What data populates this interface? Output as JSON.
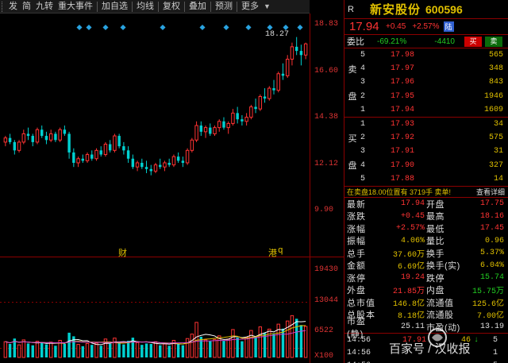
{
  "toolbar": {
    "items": [
      "发",
      "简",
      "九转",
      "重大事件",
      "加自选",
      "均线",
      "复权",
      "叠加",
      "预测",
      "更多"
    ]
  },
  "chart": {
    "y_labels": [
      "18.83",
      "16.60",
      "14.38",
      "12.12",
      "9.90"
    ],
    "max_annot": "18.27",
    "events": [
      {
        "text": "财"
      },
      {
        "text": "港"
      },
      {
        "text": "q"
      }
    ],
    "vol_labels": [
      "19430",
      "13044",
      "6522"
    ],
    "vol_unit": "X100"
  },
  "chart_data": {
    "type": "candlestick",
    "ylim": [
      9.9,
      18.83
    ],
    "volume_ylim": [
      0,
      19430
    ],
    "max_price": 18.27,
    "candles": [
      [
        13.2,
        13.5,
        13.0,
        13.4
      ],
      [
        13.4,
        13.6,
        13.1,
        13.2
      ],
      [
        13.2,
        13.3,
        12.6,
        12.8
      ],
      [
        12.8,
        13.3,
        12.7,
        13.2
      ],
      [
        13.2,
        13.8,
        13.1,
        13.6
      ],
      [
        13.6,
        13.9,
        13.3,
        13.5
      ],
      [
        13.5,
        13.6,
        13.0,
        13.2
      ],
      [
        13.2,
        13.9,
        13.1,
        13.8
      ],
      [
        13.8,
        14.0,
        13.4,
        13.5
      ],
      [
        13.5,
        13.7,
        13.1,
        13.3
      ],
      [
        13.3,
        13.8,
        13.2,
        13.6
      ],
      [
        13.6,
        13.7,
        13.2,
        13.3
      ],
      [
        13.3,
        13.9,
        13.2,
        13.8
      ],
      [
        13.8,
        14.0,
        13.5,
        13.6
      ],
      [
        13.6,
        13.7,
        12.4,
        12.7
      ],
      [
        12.7,
        12.9,
        12.0,
        12.2
      ],
      [
        12.2,
        12.5,
        12.0,
        12.4
      ],
      [
        12.4,
        12.6,
        12.2,
        12.3
      ],
      [
        12.3,
        12.7,
        12.2,
        12.6
      ],
      [
        12.6,
        12.8,
        12.3,
        12.4
      ],
      [
        12.4,
        12.9,
        12.3,
        12.8
      ],
      [
        12.8,
        13.0,
        12.5,
        12.6
      ],
      [
        12.6,
        13.2,
        12.5,
        13.1
      ],
      [
        13.1,
        13.3,
        12.7,
        12.8
      ],
      [
        12.8,
        13.6,
        12.7,
        13.5
      ],
      [
        13.5,
        13.6,
        12.9,
        13.0
      ],
      [
        13.0,
        13.2,
        12.6,
        12.8
      ],
      [
        12.8,
        13.0,
        12.2,
        12.4
      ],
      [
        12.4,
        12.6,
        11.9,
        12.0
      ],
      [
        12.0,
        12.3,
        11.8,
        12.2
      ],
      [
        12.2,
        12.4,
        11.9,
        12.0
      ],
      [
        12.0,
        12.3,
        11.7,
        11.9
      ],
      [
        11.9,
        12.1,
        11.6,
        11.8
      ],
      [
        11.8,
        12.2,
        11.7,
        12.1
      ],
      [
        12.1,
        12.4,
        11.9,
        12.0
      ],
      [
        12.0,
        12.3,
        11.8,
        12.2
      ],
      [
        12.2,
        12.4,
        12.0,
        12.1
      ],
      [
        12.1,
        12.6,
        12.0,
        12.5
      ],
      [
        12.5,
        12.7,
        12.2,
        12.3
      ],
      [
        12.3,
        12.5,
        12.0,
        12.2
      ],
      [
        12.2,
        12.9,
        12.1,
        12.8
      ],
      [
        12.8,
        13.4,
        12.7,
        13.3
      ],
      [
        13.3,
        14.2,
        13.2,
        14.0
      ],
      [
        14.0,
        14.2,
        13.5,
        13.7
      ],
      [
        13.7,
        14.0,
        13.4,
        13.9
      ],
      [
        13.9,
        14.1,
        13.5,
        13.6
      ],
      [
        13.6,
        14.0,
        13.5,
        13.9
      ],
      [
        13.9,
        14.3,
        13.7,
        14.2
      ],
      [
        14.2,
        14.4,
        13.8,
        13.9
      ],
      [
        13.9,
        14.2,
        13.6,
        14.1
      ],
      [
        14.1,
        14.8,
        14.0,
        14.6
      ],
      [
        14.6,
        14.9,
        14.1,
        14.3
      ],
      [
        14.3,
        14.5,
        14.0,
        14.2
      ],
      [
        14.2,
        14.6,
        14.0,
        14.4
      ],
      [
        14.4,
        15.0,
        14.3,
        14.9
      ],
      [
        14.9,
        15.3,
        14.6,
        14.8
      ],
      [
        14.8,
        15.5,
        14.7,
        15.4
      ],
      [
        15.4,
        15.8,
        15.1,
        15.3
      ],
      [
        15.3,
        15.9,
        15.2,
        15.8
      ],
      [
        15.8,
        16.2,
        15.5,
        15.7
      ],
      [
        15.7,
        16.6,
        15.6,
        16.5
      ],
      [
        16.5,
        17.0,
        16.2,
        16.4
      ],
      [
        16.4,
        17.4,
        16.3,
        17.2
      ],
      [
        17.2,
        18.0,
        16.9,
        17.8
      ],
      [
        17.8,
        18.27,
        17.4,
        17.6
      ],
      [
        17.6,
        17.9,
        16.9,
        17.4
      ],
      [
        17.4,
        18.0,
        17.2,
        17.94
      ]
    ],
    "volume": [
      3500,
      3000,
      4200,
      2800,
      3900,
      3100,
      2700,
      3600,
      3300,
      2900,
      3400,
      2600,
      3800,
      3000,
      5500,
      4700,
      2900,
      2500,
      3100,
      2800,
      3200,
      2600,
      4100,
      3000,
      4300,
      3200,
      2900,
      3700,
      4400,
      3300,
      2800,
      3100,
      3000,
      3500,
      2700,
      3000,
      2600,
      3800,
      2900,
      2700,
      4200,
      5200,
      7800,
      4600,
      3900,
      3600,
      4000,
      4800,
      3700,
      4100,
      6200,
      4400,
      3600,
      4500,
      6000,
      4700,
      6800,
      5400,
      6300,
      5200,
      7400,
      6400,
      8100,
      9300,
      8600,
      7200,
      6900
    ]
  },
  "quote": {
    "r_badge": "R",
    "name": "新安股份",
    "code": "600596",
    "price": "17.94",
    "change": "+0.45",
    "change_pct": "+2.57%",
    "market_badge": "陆",
    "weibi_label": "委比",
    "weibi_pct": "-69.21%",
    "weicha": "-4410",
    "buy_btn": "买",
    "sell_btn": "卖",
    "sell_side_chars": [
      "卖",
      "盘"
    ],
    "buy_side_chars": [
      "买",
      "盘"
    ],
    "asks": [
      {
        "level": "5",
        "price": "17.98",
        "vol": "565"
      },
      {
        "level": "4",
        "price": "17.97",
        "vol": "348"
      },
      {
        "level": "3",
        "price": "17.96",
        "vol": "843"
      },
      {
        "level": "2",
        "price": "17.95",
        "vol": "1946"
      },
      {
        "level": "1",
        "price": "17.94",
        "vol": "1609"
      }
    ],
    "bids": [
      {
        "level": "1",
        "price": "17.93",
        "vol": "34"
      },
      {
        "level": "2",
        "price": "17.92",
        "vol": "575"
      },
      {
        "level": "3",
        "price": "17.91",
        "vol": "31"
      },
      {
        "level": "4",
        "price": "17.90",
        "vol": "327"
      },
      {
        "level": "5",
        "price": "17.88",
        "vol": "14"
      }
    ],
    "note": "在卖盘18.00位置有 3719手 卖单!",
    "detail_link": "查看详细",
    "stats": [
      {
        "k": "最新",
        "v": "17.94",
        "vc": "red",
        "k2": "开盘",
        "v2": "17.75",
        "v2c": "red"
      },
      {
        "k": "涨跌",
        "v": "+0.45",
        "vc": "red",
        "k2": "最高",
        "v2": "18.16",
        "v2c": "red"
      },
      {
        "k": "涨幅",
        "v": "+2.57%",
        "vc": "red",
        "k2": "最低",
        "v2": "17.45",
        "v2c": "red"
      },
      {
        "k": "振幅",
        "v": "4.06%",
        "vc": "yellow",
        "k2": "量比",
        "v2": "0.96",
        "v2c": "yellow"
      },
      {
        "k": "总手",
        "v": "37.60万",
        "vc": "yellow",
        "k2": "换手",
        "v2": "5.37%",
        "v2c": "yellow"
      },
      {
        "k": "金额",
        "v": "6.69亿",
        "vc": "yellow",
        "k2": "换手(实)",
        "v2": "6.04%",
        "v2c": "yellow"
      },
      {
        "k": "涨停",
        "v": "19.24",
        "vc": "red",
        "k2": "跌停",
        "v2": "15.74",
        "v2c": "green"
      },
      {
        "k": "外盘",
        "v": "21.85万",
        "vc": "red",
        "k2": "内盘",
        "v2": "15.75万",
        "v2c": "green"
      },
      {
        "k": "总市值",
        "v": "146.8亿",
        "vc": "yellow",
        "k2": "流通值",
        "v2": "125.6亿",
        "v2c": "yellow"
      },
      {
        "k": "总股本",
        "v": "8.18亿",
        "vc": "yellow",
        "k2": "流通股",
        "v2": "7.00亿",
        "v2c": "yellow"
      },
      {
        "k": "市盈(静)",
        "v": "25.11",
        "vc": "white",
        "k2": "市盈(动)",
        "v2": "13.19",
        "v2c": "white"
      }
    ],
    "ticks": [
      {
        "t": "14:56",
        "p": "17.91",
        "v": "46",
        "arr": "↓",
        "n": "5"
      },
      {
        "t": "14:56",
        "p": "",
        "v": "",
        "arr": "",
        "n": "1"
      },
      {
        "t": "14:56",
        "p": "",
        "v": "",
        "arr": "",
        "n": "5"
      }
    ]
  },
  "watermark": "百家号 / 汉收报"
}
